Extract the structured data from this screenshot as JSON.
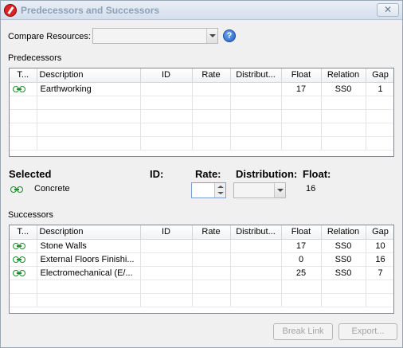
{
  "window": {
    "title": "Predecessors and Successors",
    "close_label": "✕"
  },
  "compare": {
    "label": "Compare Resources:",
    "value": "",
    "help": "?"
  },
  "predecessors": {
    "label": "Predecessors",
    "columns": [
      "T...",
      "Description",
      "ID",
      "Rate",
      "Distribut...",
      "Float",
      "Relation",
      "Gap"
    ],
    "rows": [
      {
        "icon": "link-icon",
        "description": "Earthworking",
        "id": "",
        "rate": "",
        "distribution": "",
        "float": "17",
        "relation": "SS0",
        "gap": "1"
      }
    ]
  },
  "selected": {
    "heading": "Selected",
    "id_label": "ID:",
    "rate_label": "Rate:",
    "distribution_label": "Distribution:",
    "float_label": "Float:",
    "name": "Concrete",
    "id": "",
    "rate": "",
    "distribution": "",
    "float": "16"
  },
  "successors": {
    "label": "Successors",
    "columns": [
      "T...",
      "Description",
      "ID",
      "Rate",
      "Distribut...",
      "Float",
      "Relation",
      "Gap"
    ],
    "rows": [
      {
        "icon": "link-icon",
        "description": "Stone Walls",
        "id": "",
        "rate": "",
        "distribution": "",
        "float": "17",
        "relation": "SS0",
        "gap": "10"
      },
      {
        "icon": "link-icon",
        "description": "External Floors Finishi...",
        "id": "",
        "rate": "",
        "distribution": "",
        "float": "0",
        "relation": "SS0",
        "gap": "16"
      },
      {
        "icon": "link-icon",
        "description": "Electromechanical (E/...",
        "id": "",
        "rate": "",
        "distribution": "",
        "float": "25",
        "relation": "SS0",
        "gap": "7"
      }
    ]
  },
  "buttons": {
    "break_link": "Break Link",
    "export": "Export..."
  },
  "colors": {
    "link_icon": "#1f8a2e",
    "title_text": "#8da0b6",
    "disabled_text": "#a3a3a3"
  }
}
